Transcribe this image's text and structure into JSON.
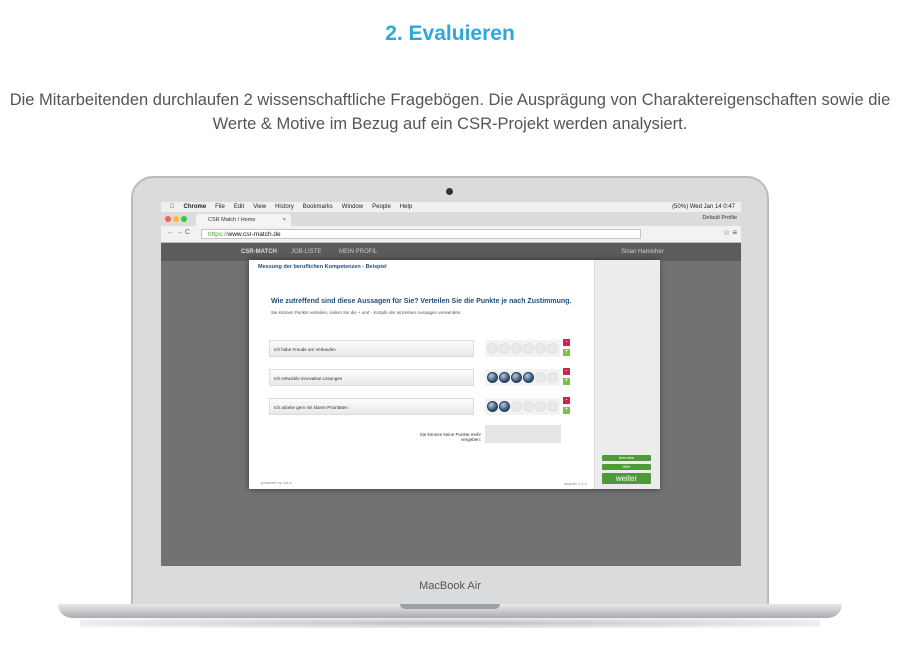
{
  "heading": "2. Evaluieren",
  "intro": "Die Mitarbeitenden durchlaufen 2 wissenschaftliche Fragebögen. Die Ausprägung von Charaktereigenschaften sowie die Werte & Motive im Bezug auf ein CSR-Projekt werden analysiert.",
  "laptop": {
    "brand": "MacBook Air"
  },
  "menubar": {
    "items": [
      "Chrome",
      "File",
      "Edit",
      "View",
      "History",
      "Bookmarks",
      "Window",
      "People",
      "Help"
    ],
    "status": "(50%)  Wed Jan 14  0:47"
  },
  "browser": {
    "tab_title": "CSR Match / Home",
    "profile": "Default Profile",
    "url": "https://www.csr-match.de",
    "url_scheme": "https://",
    "url_host": "www.csr-match.de"
  },
  "site": {
    "logo": "CSR-MATCH",
    "nav": [
      "JOB-LISTE",
      "MEIN PROFIL"
    ],
    "user": "Sinan Hamisher"
  },
  "modal": {
    "title": "Messung der beruflichen Kompetenzen - Beispiel",
    "question": "Wie zutreffend sind diese Aussagen für Sie? Verteilen Sie die Punkte je nach Zustimmung.",
    "instruction": "Sie können Punkte verteilen, indem Sie die + und - Knöpfe der einzelnen Aussagen verwenden.",
    "statements": [
      {
        "text": "Ich habe Freude am Verkaufen",
        "points": 0,
        "max": 6
      },
      {
        "text": "Ich entwickle innovative Lösungen",
        "points": 4,
        "max": 6
      },
      {
        "text": "Ich arbeite gern mit klaren Prioritäten",
        "points": 2,
        "max": 6
      }
    ],
    "remaining_label": "Sie können keine Punkte mehr vergeben:",
    "buttons": {
      "b1": "beenden",
      "b2": "Hilfe",
      "next": "weiter"
    },
    "powered": "powered by cut-e",
    "version": "shapes 1.0.0"
  },
  "colors": {
    "accent": "#2ea7dc",
    "dark_blue": "#1f4d7a",
    "minus": "#c8264a",
    "plus": "#7cc04a",
    "action": "#4e9a3a"
  }
}
